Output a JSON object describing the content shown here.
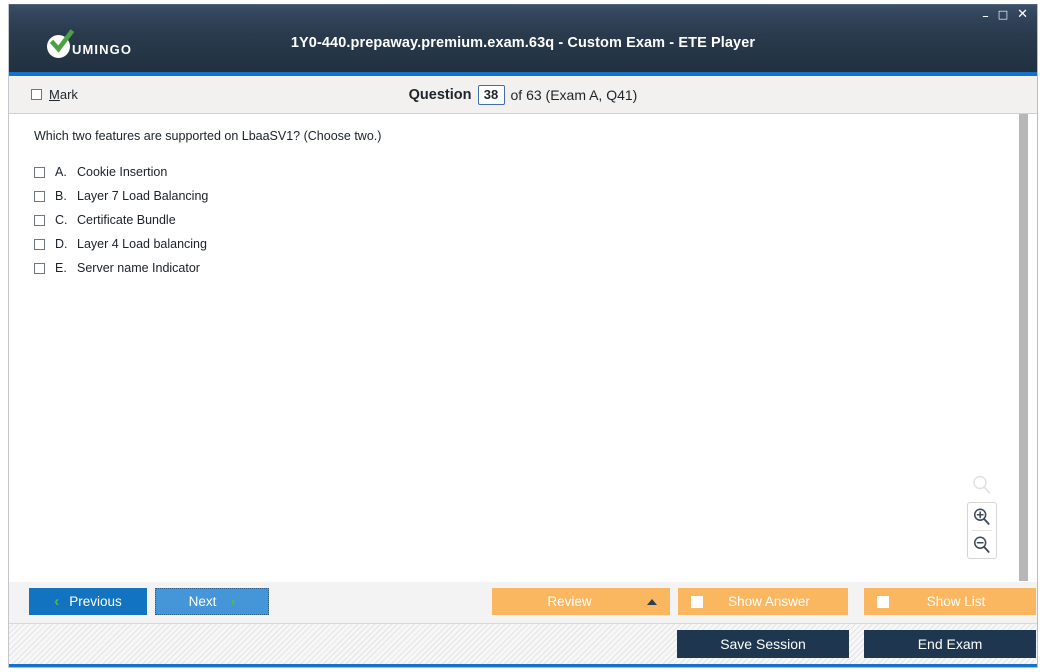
{
  "window": {
    "title": "1Y0-440.prepaway.premium.exam.63q - Custom Exam - ETE Player",
    "brand": "UMINGO",
    "controls": {
      "minimize": "–",
      "maximize": "□",
      "close": "✕"
    }
  },
  "header": {
    "mark_label_prefix": "",
    "mark_label_accel": "M",
    "mark_label_rest": "ark",
    "question_word": "Question",
    "question_number": "38",
    "rest": "of 63 (Exam A, Q41)"
  },
  "question": {
    "text": "Which two features are supported on LbaaSV1? (Choose two.)",
    "options": [
      {
        "letter": "A.",
        "text": "Cookie Insertion",
        "checked": false
      },
      {
        "letter": "B.",
        "text": "Layer 7 Load Balancing",
        "checked": false
      },
      {
        "letter": "C.",
        "text": "Certificate Bundle",
        "checked": false
      },
      {
        "letter": "D.",
        "text": "Layer 4 Load balancing",
        "checked": false
      },
      {
        "letter": "E.",
        "text": "Server name Indicator",
        "checked": false
      }
    ]
  },
  "zoom_tools": {
    "reset_icon": "magnifier-icon",
    "zoom_in_icon": "zoom-in-icon",
    "zoom_out_icon": "zoom-out-icon"
  },
  "actions": {
    "previous": "Previous",
    "next": "Next",
    "review": "Review",
    "show_answer": "Show Answer",
    "show_list": "Show List",
    "prev_chevron": "‹",
    "next_chevron": "›"
  },
  "status": {
    "save_session": "Save Session",
    "end_exam": "End Exam"
  },
  "colors": {
    "titlebar": "#2a3a4d",
    "accent_blue": "#1473c8",
    "primary_button": "#1273c0",
    "next_button": "#4596d8",
    "orange_button": "#fbb760",
    "dark_button": "#1f3650",
    "chevron_green": "#58b947"
  }
}
